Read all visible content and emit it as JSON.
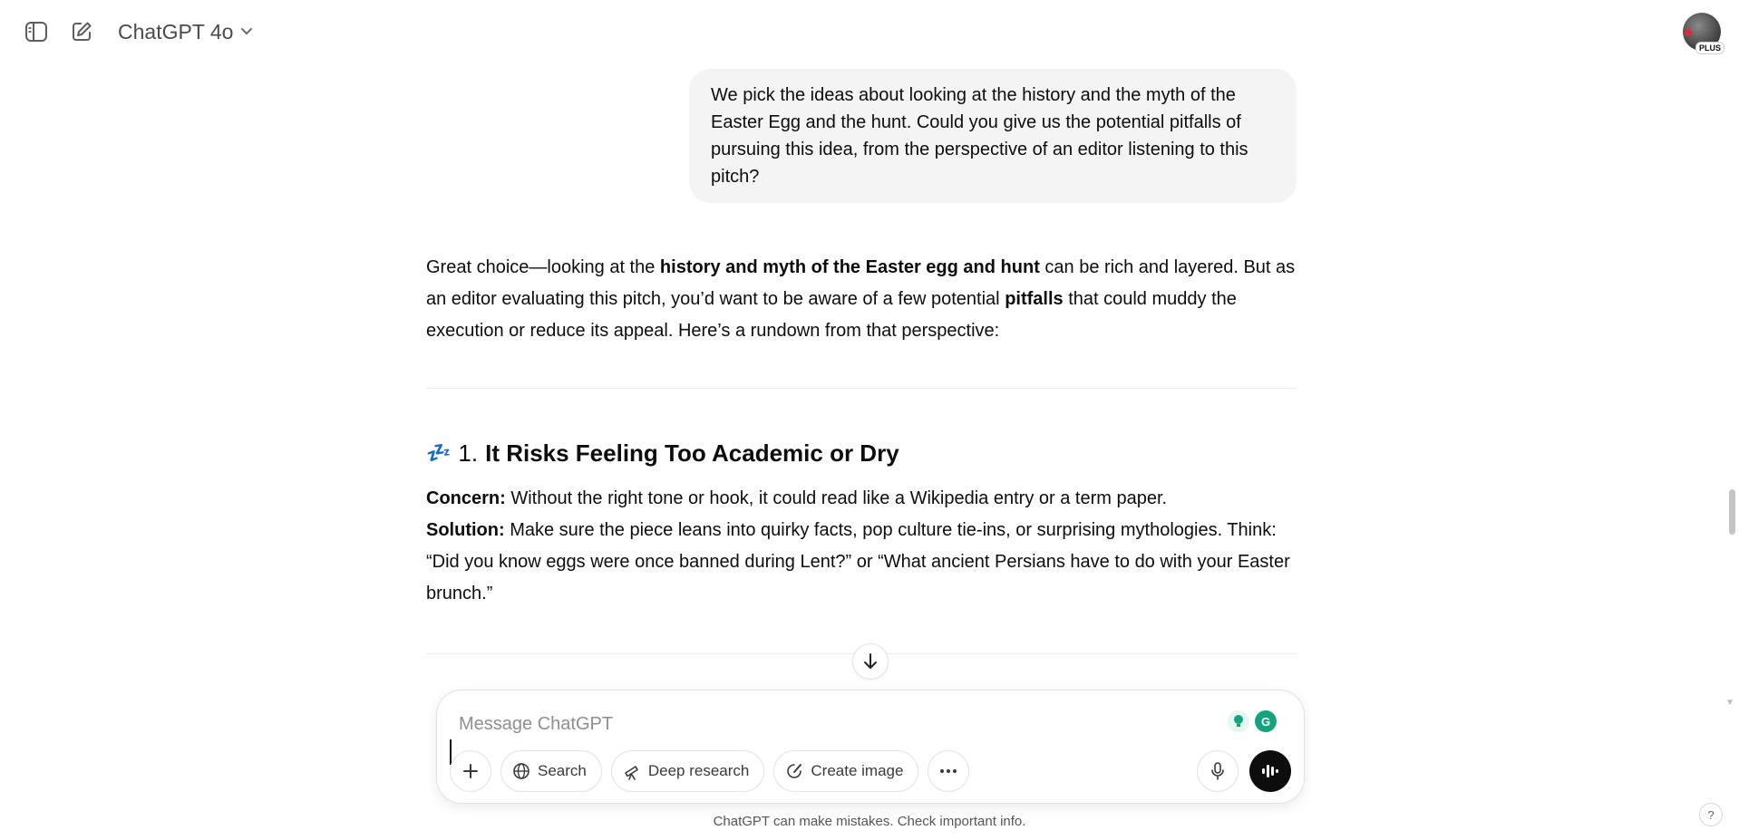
{
  "header": {
    "model_name": "ChatGPT 4o",
    "avatar_badge": "PLUS"
  },
  "conversation": {
    "user_message": "We pick the ideas about looking at the history and the myth of the Easter Egg and the hunt. Could you give us the potential pitfalls of pursuing this idea, from the perspective of an editor listening to this pitch?",
    "assistant_intro": {
      "part1": "Great choice—looking at the ",
      "bold1": "history and myth of the Easter egg and hunt",
      "part2": " can be rich and layered. But as an editor evaluating this pitch, you’d want to be aware of a few potential ",
      "bold2": "pitfalls",
      "part3": " that could muddy the execution or reduce its appeal. Here’s a rundown from that perspective:"
    },
    "section1": {
      "emoji": "💤",
      "number": "1.",
      "title": "It Risks Feeling Too Academic or Dry",
      "concern_label": "Concern:",
      "concern_text": " Without the right tone or hook, it could read like a Wikipedia entry or a term paper.",
      "solution_label": "Solution:",
      "solution_text": " Make sure the piece leans into quirky facts, pop culture tie-ins, or surprising mythologies. Think: “Did you know eggs were once banned during Lent?” or “What ancient Persians have to do with your Easter brunch.”"
    }
  },
  "composer": {
    "placeholder": "Message ChatGPT",
    "tools": [
      "Search",
      "Deep research",
      "Create image"
    ]
  },
  "footer": {
    "disclaimer": "ChatGPT can make mistakes. Check important info.",
    "help": "?"
  },
  "colors": {
    "bubble_bg": "#f4f4f4",
    "voice_button": "#0d0d0d",
    "grammarly_green": "#15c39a"
  }
}
